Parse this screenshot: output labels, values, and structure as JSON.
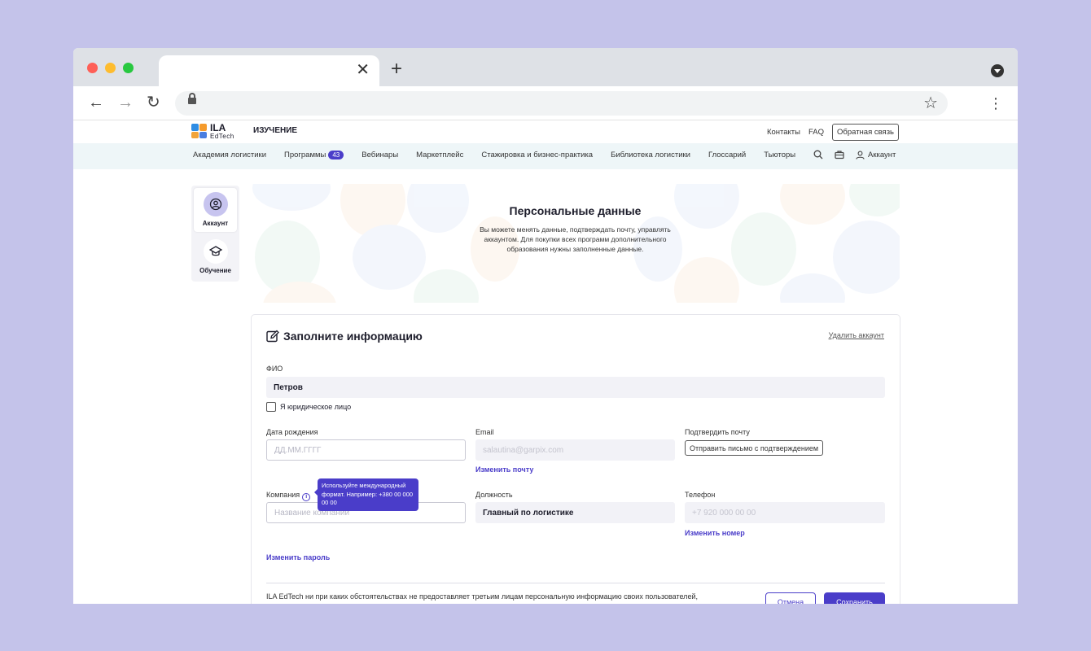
{
  "browser": {
    "tab_close": "✕",
    "new_tab": "+",
    "back": "←",
    "forward": "→",
    "reload": "↻",
    "star": "☆",
    "menu": "⋮"
  },
  "header": {
    "logo_title": "ILA",
    "logo_subtitle": "EdTech",
    "section": "ИЗУЧЕНИЕ",
    "links": [
      "Контакты",
      "FAQ"
    ],
    "feedback_label": "Обратная связь"
  },
  "nav": {
    "items": [
      {
        "label": "Академия логистики"
      },
      {
        "label": "Программы",
        "badge": "43"
      },
      {
        "label": "Вебинары"
      },
      {
        "label": "Маркетплейс"
      },
      {
        "label": "Стажировка и бизнес-практика"
      },
      {
        "label": "Библиотека логистики"
      },
      {
        "label": "Глоссарий"
      },
      {
        "label": "Тьюторы"
      }
    ],
    "account_label": "Аккаунт"
  },
  "sidebar": {
    "items": [
      {
        "label": "Аккаунт",
        "icon": "user-circle-icon"
      },
      {
        "label": "Обучение",
        "icon": "graduation-cap-icon"
      }
    ]
  },
  "hero": {
    "title": "Персональные данные",
    "text": "Вы можете менять данные, подтверждать почту, управлять аккаунтом. Для покупки всех программ дополнительного образования нужны заполненные данные."
  },
  "form": {
    "title": "Заполните информацию",
    "delete_account": "Удалить аккаунт",
    "fio_label": "ФИО",
    "fio_value": "Петров",
    "legal_entity_label": "Я юридическое лицо",
    "birth_label": "Дата рождения",
    "birth_placeholder": "ДД.ММ.ГГГГ",
    "email_label": "Email",
    "email_value": "salautina@garpix.com",
    "change_email": "Изменить почту",
    "confirm_label": "Подтвердить почту",
    "confirm_button": "Отправить письмо с подтверждением",
    "company_label": "Компания",
    "company_placeholder": "Название компании",
    "tooltip": "Используйте международный формат. Например: +380 00 000 00 00",
    "position_label": "Должность",
    "position_value": "Главный по логистике",
    "phone_label": "Телефон",
    "phone_value": "+7 920 000 00 00",
    "change_phone": "Изменить номер",
    "change_password": "Изменить пароль",
    "footer_text": "ILA EdTech ни при каких обстоятельствах не предоставляет третьим лицам персональную информацию своих пользователей,",
    "cancel": "Отмена",
    "save": "Сохранить"
  },
  "colors": {
    "accent": "#4a3dc9",
    "background": "#c4c3ea",
    "nav_bg": "#eef6f8"
  }
}
